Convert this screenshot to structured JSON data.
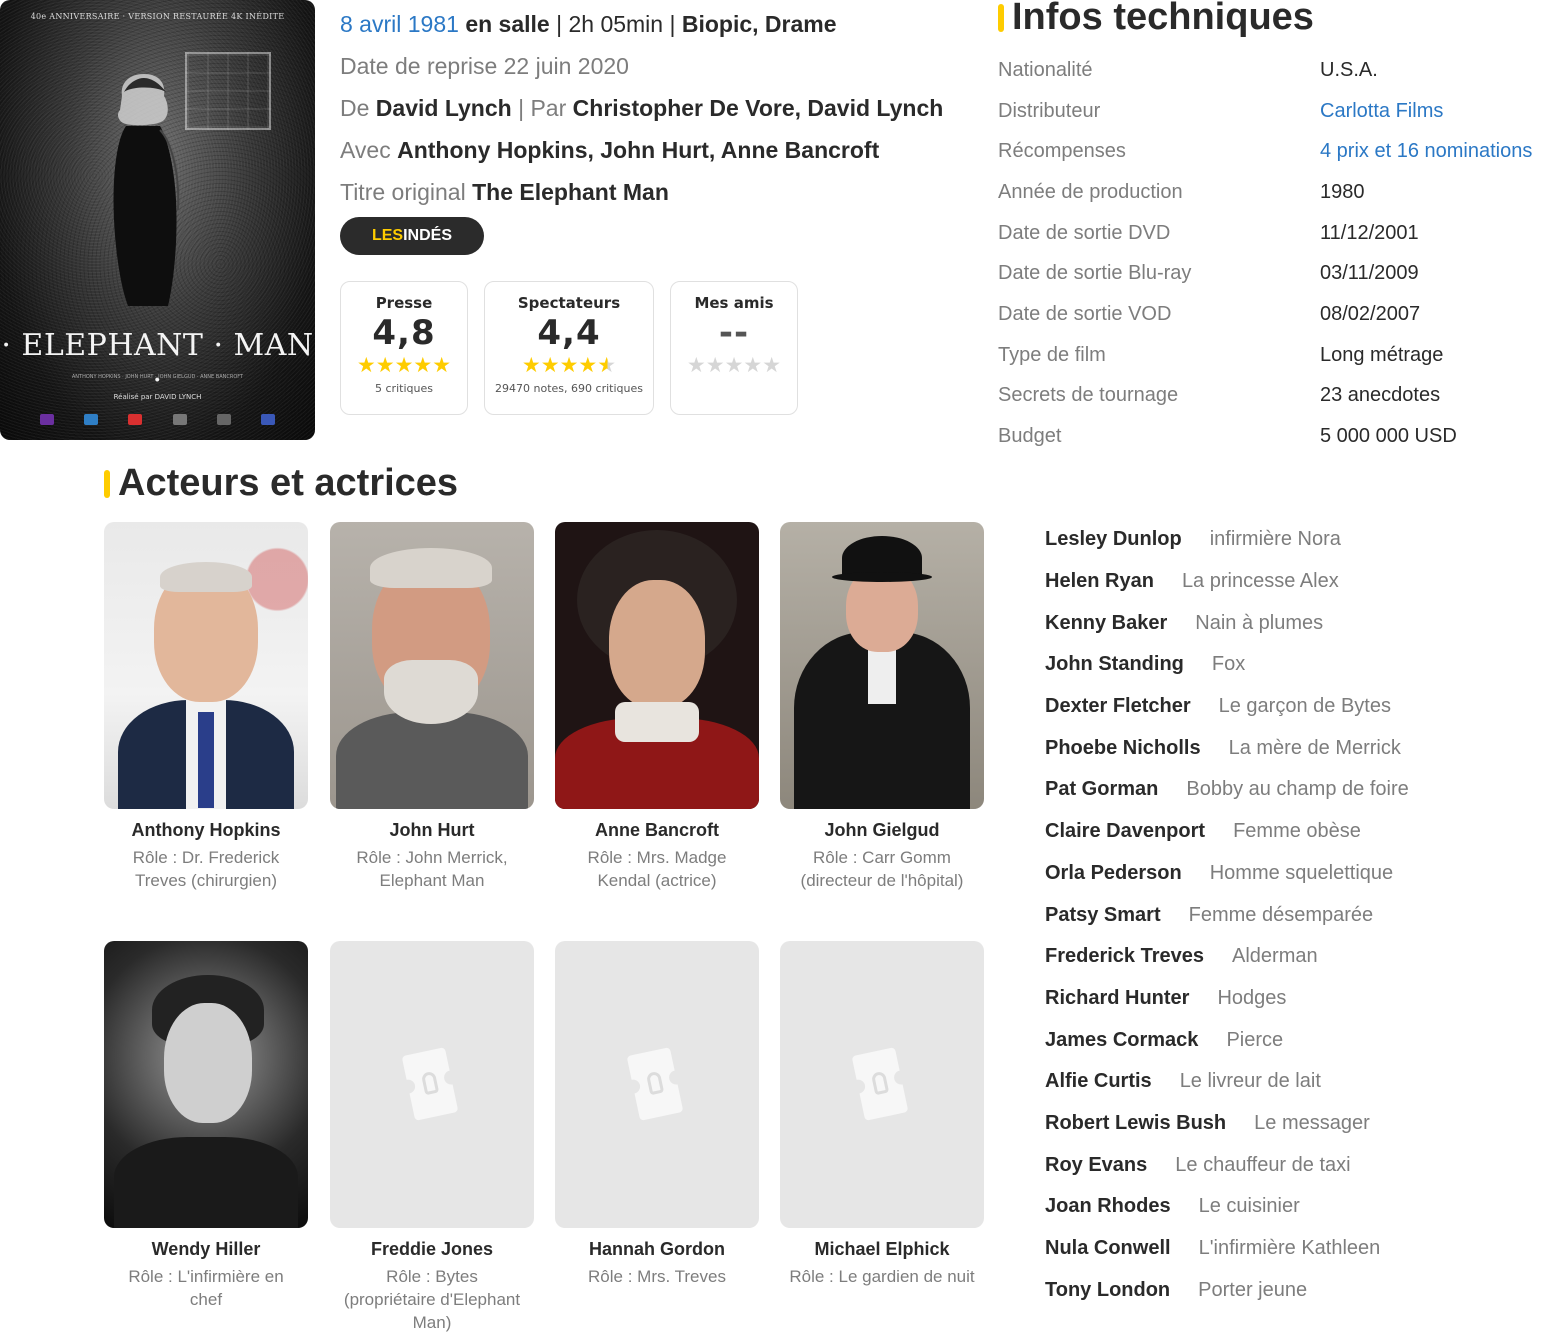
{
  "poster": {
    "tagline": "40e ANNIVERSAIRE · VERSION RESTAURÉE 4K INÉDITE",
    "title": "· ELEPHANT · MAN ·",
    "credits": "ANTHONY HOPKINS · JOHN HURT · JOHN GIELGUD · ANNE BANCROFT",
    "director": "Réalisé par DAVID LYNCH"
  },
  "meta": {
    "release_date": "8 avril 1981",
    "release_where": "en salle",
    "duration": "2h 05min",
    "genres": "Biopic, Drame",
    "rerelease_label": "Date de reprise",
    "rerelease_date": "22 juin 2020",
    "director_label": "De",
    "director": "David Lynch",
    "writers_label": "Par",
    "writers": "Christopher De Vore, David Lynch",
    "cast_label": "Avec",
    "cast": "Anthony Hopkins, John Hurt, Anne Bancroft",
    "original_title_label": "Titre original",
    "original_title": "The Elephant Man",
    "badge_prefix": "LES",
    "badge_suffix": "INDÉS",
    "pipe": "|"
  },
  "ratings": [
    {
      "label": "Presse",
      "value": "4,8",
      "stars": 4.8,
      "sub": "5 critiques"
    },
    {
      "label": "Spectateurs",
      "value": "4,4",
      "stars": 4.4,
      "sub": "29470 notes, 690 critiques"
    },
    {
      "label": "Mes amis",
      "value": "--",
      "stars": 0,
      "sub": ""
    }
  ],
  "tech": {
    "title": "Infos techniques",
    "rows": [
      {
        "label": "Nationalité",
        "value": "U.S.A."
      },
      {
        "label": "Distributeur",
        "value": "Carlotta Films"
      },
      {
        "label": "Récompenses",
        "value": "4 prix et 16 nominations"
      },
      {
        "label": "Année de production",
        "value": "1980"
      },
      {
        "label": "Date de sortie DVD",
        "value": "11/12/2001"
      },
      {
        "label": "Date de sortie Blu-ray",
        "value": "03/11/2009"
      },
      {
        "label": "Date de sortie VOD",
        "value": "08/02/2007"
      },
      {
        "label": "Type de film",
        "value": "Long métrage"
      },
      {
        "label": "Secrets de tournage",
        "value": "23 anecdotes"
      },
      {
        "label": "Budget",
        "value": "5 000 000 USD"
      }
    ]
  },
  "cast_section": {
    "title": "Acteurs et actrices",
    "main": [
      {
        "name": "Anthony Hopkins",
        "role": "Rôle : Dr. Frederick Treves (chirurgien)"
      },
      {
        "name": "John Hurt",
        "role": "Rôle : John Merrick, Elephant Man"
      },
      {
        "name": "Anne Bancroft",
        "role": "Rôle : Mrs. Madge Kendal (actrice)"
      },
      {
        "name": "John Gielgud",
        "role": "Rôle : Carr Gomm (directeur de l'hôpital)"
      },
      {
        "name": "Wendy Hiller",
        "role": "Rôle : L'infirmière en chef"
      },
      {
        "name": "Freddie Jones",
        "role": "Rôle : Bytes (propriétaire d'Elephant Man)"
      },
      {
        "name": "Hannah Gordon",
        "role": "Rôle : Mrs. Treves"
      },
      {
        "name": "Michael Elphick",
        "role": "Rôle : Le gardien de nuit"
      }
    ],
    "more": [
      {
        "name": "Lesley Dunlop",
        "role": "infirmière Nora"
      },
      {
        "name": "Helen Ryan",
        "role": "La princesse Alex"
      },
      {
        "name": "Kenny Baker",
        "role": "Nain à plumes"
      },
      {
        "name": "John Standing",
        "role": "Fox"
      },
      {
        "name": "Dexter Fletcher",
        "role": "Le garçon de Bytes"
      },
      {
        "name": "Phoebe Nicholls",
        "role": "La mère de Merrick"
      },
      {
        "name": "Pat Gorman",
        "role": "Bobby au champ de foire"
      },
      {
        "name": "Claire Davenport",
        "role": "Femme obèse"
      },
      {
        "name": "Orla Pederson",
        "role": "Homme squelettique"
      },
      {
        "name": "Patsy Smart",
        "role": "Femme désemparée"
      },
      {
        "name": "Frederick Treves",
        "role": "Alderman"
      },
      {
        "name": "Richard Hunter",
        "role": "Hodges"
      },
      {
        "name": "James Cormack",
        "role": "Pierce"
      },
      {
        "name": "Alfie Curtis",
        "role": "Le livreur de lait"
      },
      {
        "name": "Robert Lewis Bush",
        "role": "Le messager"
      },
      {
        "name": "Roy Evans",
        "role": "Le chauffeur de taxi"
      },
      {
        "name": "Joan Rhodes",
        "role": "Le cuisinier"
      },
      {
        "name": "Nula Conwell",
        "role": "L'infirmière Kathleen"
      },
      {
        "name": "Tony London",
        "role": "Porter jeune"
      }
    ]
  },
  "colors": {
    "accent": "#fecc00",
    "link": "#2b78c5",
    "text": "#2a2a2a",
    "muted": "#7d7d7d",
    "badge_bg": "#2b2b2b"
  }
}
